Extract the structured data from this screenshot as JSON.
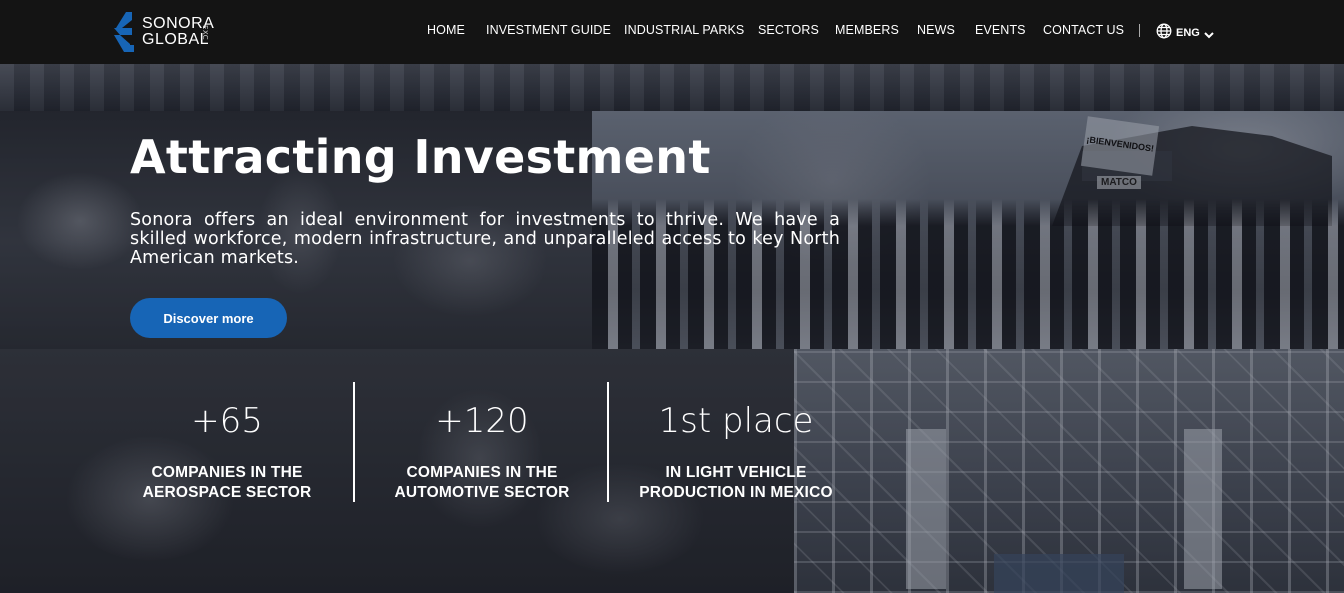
{
  "brand": {
    "name_line1": "SONORA",
    "name_line2": "GLOBAL",
    "name_sub": "EXC",
    "accent": "#1765b6"
  },
  "nav": {
    "items": [
      {
        "label": "HOME"
      },
      {
        "label": "INVESTMENT GUIDE"
      },
      {
        "label": "INDUSTRIAL PARKS"
      },
      {
        "label": "SECTORS"
      },
      {
        "label": "MEMBERS"
      },
      {
        "label": "NEWS"
      },
      {
        "label": "EVENTS"
      },
      {
        "label": "CONTACT US"
      }
    ],
    "language": {
      "icon": "globe-icon",
      "label": "ENG",
      "caret_icon": "chevron-down-icon"
    }
  },
  "hero": {
    "title": "Attracting Investment",
    "description": "Sonora offers an ideal environment for investments to thrive. We have a skilled workforce, modern infrastructure, and unparalleled access to key North American markets.",
    "cta_label": "Discover more",
    "photo_banner_text": "¡BIENVENIDOS!",
    "photo_sign_text": "MATCO"
  },
  "stats": [
    {
      "value": "+65",
      "label": "COMPANIES IN THE AEROSPACE SECTOR"
    },
    {
      "value": "+120",
      "label": "COMPANIES IN THE AUTOMOTIVE SECTOR"
    },
    {
      "value": "1st place",
      "label": "IN LIGHT VEHICLE PRODUCTION IN MEXICO"
    }
  ]
}
